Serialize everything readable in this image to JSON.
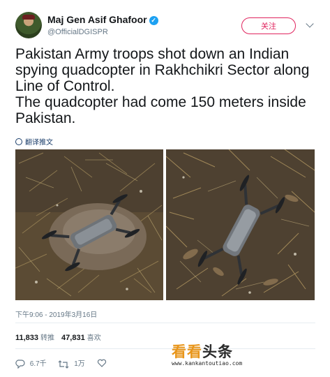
{
  "author": {
    "name": "Maj Gen Asif Ghafoor",
    "handle": "@OfficialDGISPR",
    "verified": true
  },
  "header": {
    "follow_label": "关注"
  },
  "tweet": {
    "lines": [
      "Pakistan Army troops shot down an Indian spying quadcopter in Rakhchikri Sector along Line of Control.",
      "The quadcopter had come 150 meters inside Pakistan."
    ],
    "translate_label": "翻译推文",
    "timestamp": "下午9:06 - 2019年3月16日"
  },
  "stats": {
    "retweets_count": "11,833",
    "retweets_label": "转推",
    "likes_count": "47,831",
    "likes_label": "喜欢"
  },
  "actions": {
    "replies": "6.7千",
    "retweets": "1万"
  },
  "watermark": {
    "main_a": "看看",
    "main_b": "头条",
    "url": "www.kankantoutiao.com"
  },
  "colors": {
    "follow_accent": "#e0245e",
    "verified_blue": "#1da1f2",
    "muted_text": "#657786"
  }
}
